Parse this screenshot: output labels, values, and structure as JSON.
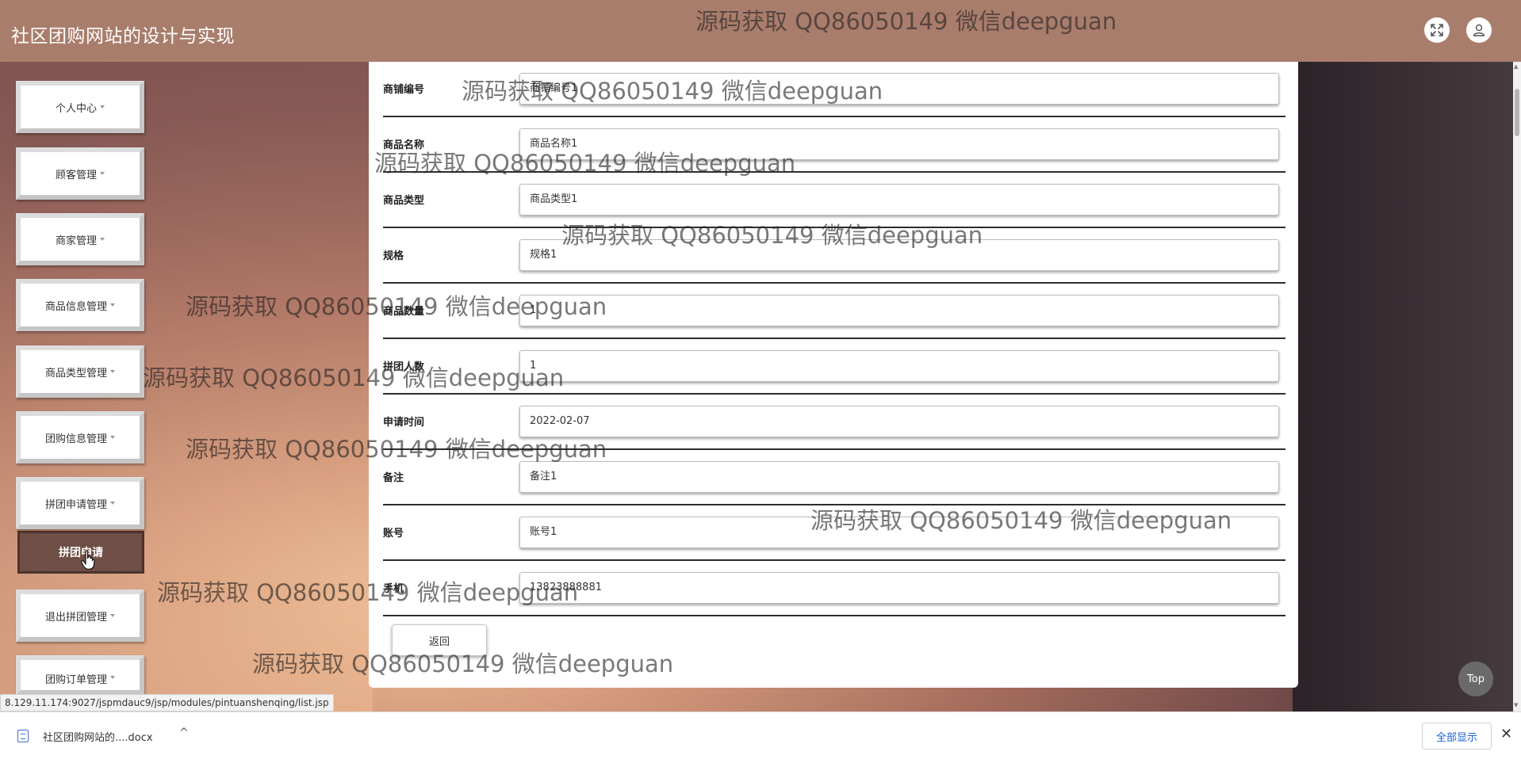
{
  "header": {
    "title": "社区团购网站的设计与实现",
    "fullscreen_icon": "expand-arrows-icon",
    "user_icon": "user-icon"
  },
  "sidebar": {
    "items": [
      {
        "label": "个人中心"
      },
      {
        "label": "顾客管理"
      },
      {
        "label": "商家管理"
      },
      {
        "label": "商品信息管理"
      },
      {
        "label": "商品类型管理"
      },
      {
        "label": "团购信息管理"
      },
      {
        "label": "拼团申请管理"
      },
      {
        "label": "退出拼团管理"
      },
      {
        "label": "团购订单管理"
      }
    ],
    "active_sub": "拼团申请"
  },
  "form": {
    "fields": [
      {
        "label": "商铺编号",
        "value": "商铺编号1"
      },
      {
        "label": "商品名称",
        "value": "商品名称1"
      },
      {
        "label": "商品类型",
        "value": "商品类型1"
      },
      {
        "label": "规格",
        "value": "规格1"
      },
      {
        "label": "商品数量",
        "value": "1"
      },
      {
        "label": "拼团人数",
        "value": "1"
      },
      {
        "label": "申请时间",
        "value": "2022-02-07"
      },
      {
        "label": "备注",
        "value": "备注1"
      },
      {
        "label": "账号",
        "value": "账号1"
      },
      {
        "label": "手机",
        "value": "13823888881"
      }
    ],
    "back_label": "返回"
  },
  "top_button": "Top",
  "status_url": "8.129.11.174:9027/jspmdauc9/jsp/modules/pintuanshenqing/list.jsp",
  "download_bar": {
    "file_name": "社区团购网站的....docx",
    "show_all": "全部显示",
    "close": "✕",
    "chevron": "^"
  },
  "watermark": "源码获取 QQ86050149 微信deepguan"
}
